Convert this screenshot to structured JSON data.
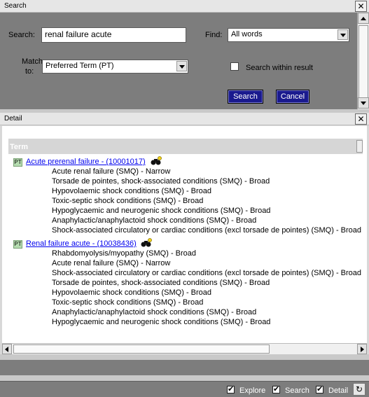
{
  "search_panel": {
    "title": "Search",
    "search_label": "Search:",
    "search_value": "renal failure acute",
    "find_label": "Find:",
    "find_value": "All words",
    "match_label_line1": "Match",
    "match_label_line2": "to:",
    "match_value": "Preferred Term (PT)",
    "within_label": "Search within result",
    "within_checked": false,
    "search_button": "Search",
    "cancel_button": "Cancel"
  },
  "detail_panel": {
    "title": "Detail",
    "column_header": "Term",
    "results": [
      {
        "badge": "PT",
        "link": "Acute prerenal failure - (10001017)",
        "smqs": [
          "Acute renal failure (SMQ) - Narrow",
          "Torsade de pointes, shock-associated conditions (SMQ) - Broad",
          "Hypovolaemic shock conditions (SMQ) - Broad",
          "Toxic-septic shock conditions (SMQ) - Broad",
          "Hypoglycaemic and neurogenic shock conditions (SMQ) - Broad",
          "Anaphylactic/anaphylactoid shock conditions (SMQ) - Broad",
          "Shock-associated circulatory or cardiac conditions (excl torsade de pointes) (SMQ) - Broad"
        ]
      },
      {
        "badge": "PT",
        "link": "Renal failure acute - (10038436)",
        "smqs": [
          "Rhabdomyolysis/myopathy (SMQ) - Broad",
          "Acute renal failure (SMQ) - Narrow",
          "Shock-associated circulatory or cardiac conditions (excl torsade de pointes) (SMQ) - Broad",
          "Torsade de pointes, shock-associated conditions (SMQ) - Broad",
          "Hypovolaemic shock conditions (SMQ) - Broad",
          "Toxic-septic shock conditions (SMQ) - Broad",
          "Anaphylactic/anaphylactoid shock conditions (SMQ) - Broad",
          "Hypoglycaemic and neurogenic shock conditions (SMQ) - Broad"
        ]
      }
    ]
  },
  "statusbar": {
    "explore_label": "Explore",
    "search_label": "Search",
    "detail_label": "Detail"
  },
  "icons": {
    "close": "close-icon",
    "find_in_hierarchy": "binoculars-icon",
    "refresh": "refresh-icon"
  },
  "colors": {
    "panel_grey": "#7d7d7d",
    "button_blue": "#1a1a8e",
    "link_blue": "#0000ee",
    "pt_badge": "#b5dcb0"
  }
}
